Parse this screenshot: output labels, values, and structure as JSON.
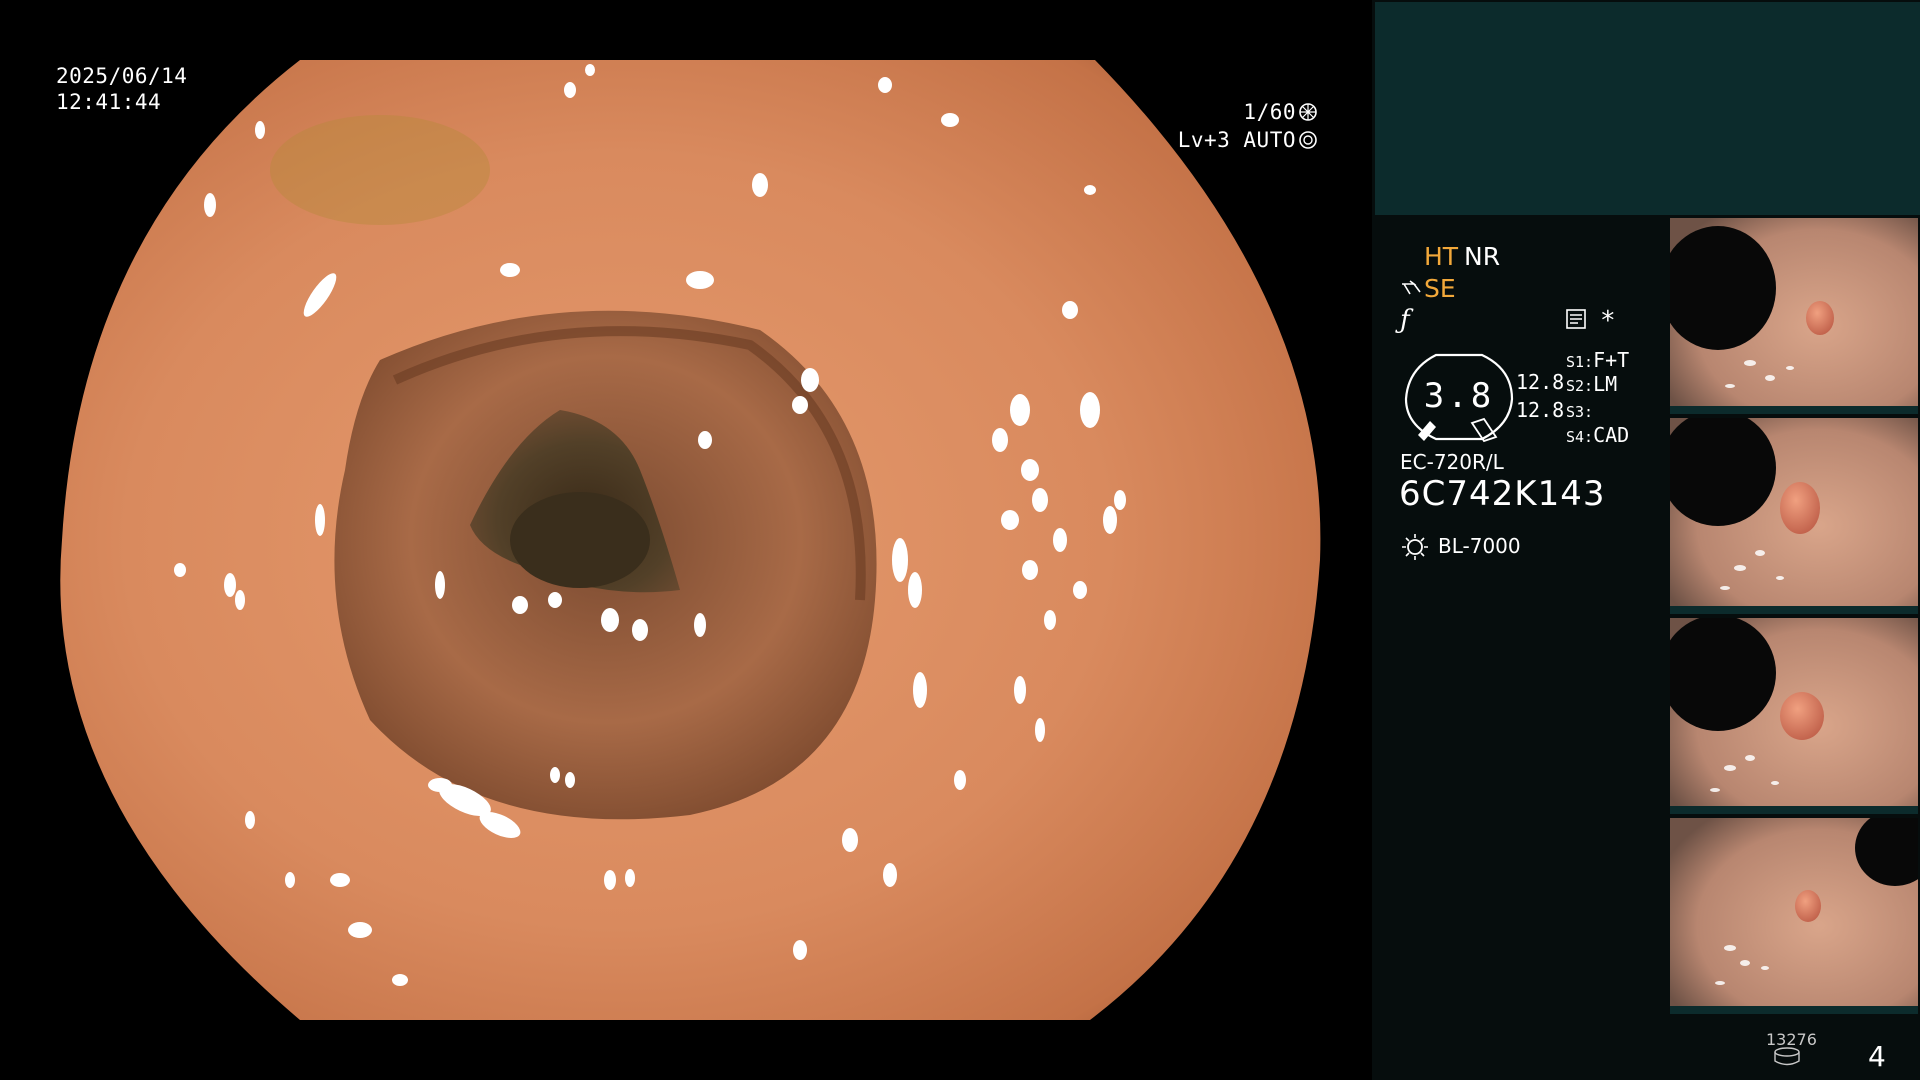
{
  "overlay": {
    "date": "2025/06/14",
    "time": "12:41:44",
    "shutter_speed": "1/60",
    "iris_mode": "Lv+3 AUTO"
  },
  "panel": {
    "ht": "HT",
    "nr": "NR",
    "se": "SE",
    "gauge_value": "3.8",
    "gauge_val1": "12.8",
    "gauge_val2": "12.8",
    "switches": [
      {
        "key": "S1:",
        "value": "F+T"
      },
      {
        "key": "S2:",
        "value": "LM"
      },
      {
        "key": "S3:",
        "value": ""
      },
      {
        "key": "S4:",
        "value": "CAD"
      }
    ],
    "scope_model": "EC-720R/L",
    "scope_serial": "6C742K143",
    "light_source": "BL-7000",
    "record_count": "13276",
    "page_number": "4"
  },
  "colors": {
    "panel_bg": "#060d0d",
    "top_strip": "#0c2b2c",
    "label_orange": "#f2a83a",
    "mucosa": "#d98a5e"
  },
  "thumbnails": [
    {
      "name": "capture-1"
    },
    {
      "name": "capture-2"
    },
    {
      "name": "capture-3"
    },
    {
      "name": "capture-4"
    }
  ]
}
